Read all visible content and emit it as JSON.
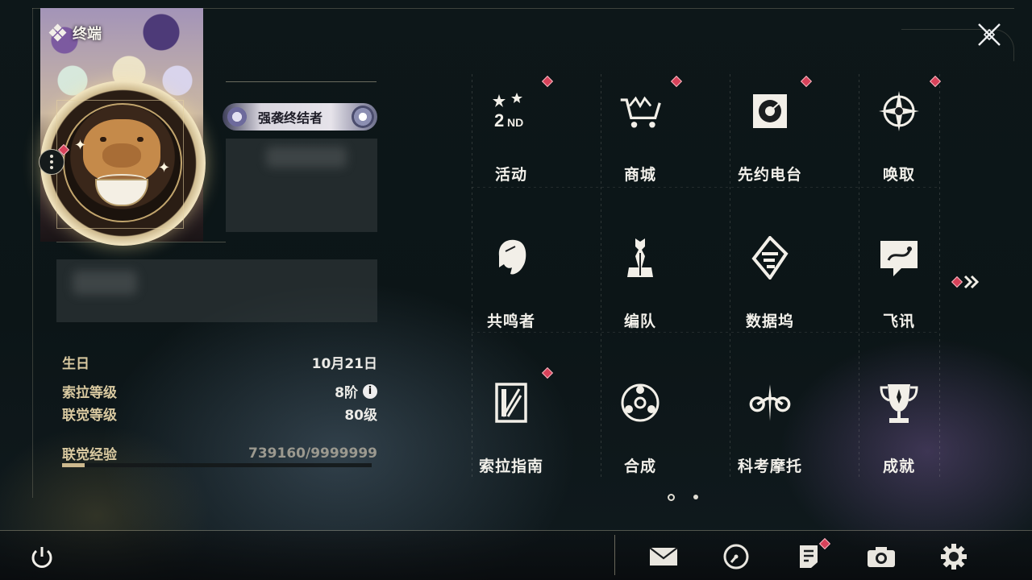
{
  "header": {
    "title": "终端"
  },
  "profile": {
    "title_badge": "强袭终结者",
    "stats": [
      {
        "label": "生日",
        "value": "10月21日"
      },
      {
        "label": "索拉等级",
        "value": "8阶"
      },
      {
        "label": "联觉等级",
        "value": "80级"
      }
    ],
    "exp": {
      "label": "联觉经验",
      "value": "739160/9999999",
      "progress_fraction": 0.074
    }
  },
  "menu": {
    "items": [
      {
        "label": "活动",
        "icon": "event-2nd-icon",
        "badge": true
      },
      {
        "label": "商城",
        "icon": "shop-cart-icon",
        "badge": true
      },
      {
        "label": "先约电台",
        "icon": "radio-icon",
        "badge": true
      },
      {
        "label": "唤取",
        "icon": "convene-compass-icon",
        "badge": true
      },
      {
        "label": "共鸣者",
        "icon": "resonator-icon",
        "badge": false
      },
      {
        "label": "编队",
        "icon": "team-chess-icon",
        "badge": false
      },
      {
        "label": "数据坞",
        "icon": "data-bank-icon",
        "badge": false
      },
      {
        "label": "飞讯",
        "icon": "message-chat-icon",
        "badge": false
      },
      {
        "label": "索拉指南",
        "icon": "guide-book-icon",
        "badge": true
      },
      {
        "label": "合成",
        "icon": "synthesis-icon",
        "badge": false
      },
      {
        "label": "科考摩托",
        "icon": "motorcycle-icon",
        "badge": false
      },
      {
        "label": "成就",
        "icon": "trophy-icon",
        "badge": false
      }
    ],
    "page_count": 2,
    "current_page": 1
  },
  "bottom_bar": {
    "buttons": [
      {
        "name": "mail",
        "icon": "mail-icon",
        "badge": false
      },
      {
        "name": "time",
        "icon": "clock-icon",
        "badge": false
      },
      {
        "name": "notice",
        "icon": "notice-icon",
        "badge": true
      },
      {
        "name": "camera",
        "icon": "camera-icon",
        "badge": false
      },
      {
        "name": "settings",
        "icon": "gear-icon",
        "badge": false
      }
    ]
  },
  "colors": {
    "accent_gold": "#cdb98e",
    "badge_red": "#d8425a",
    "text_primary": "#f2f0ea",
    "background": "#0d1719"
  }
}
